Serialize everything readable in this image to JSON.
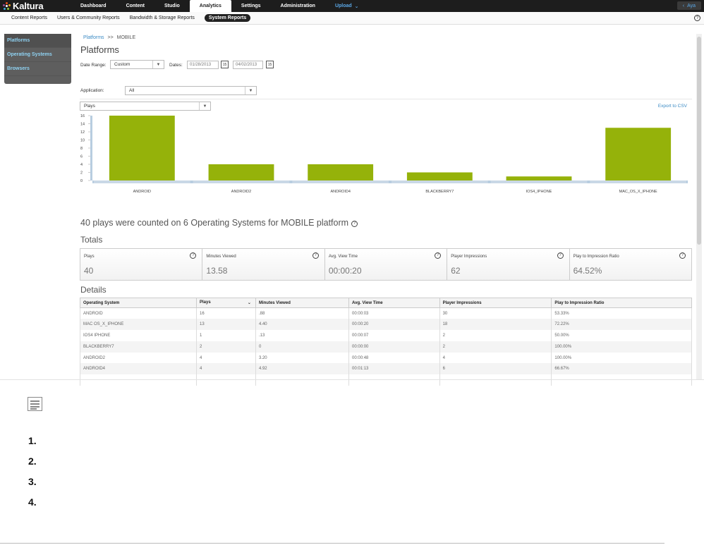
{
  "app": {
    "logo_text": "Kaltura",
    "brand_colors": [
      "#e94e1b",
      "#f7a21b",
      "#8cc63e",
      "#3aa8e0",
      "#9b4a9b"
    ]
  },
  "topnav": {
    "tabs": [
      {
        "label": "Dashboard",
        "active": false
      },
      {
        "label": "Content",
        "active": false
      },
      {
        "label": "Studio",
        "active": false
      },
      {
        "label": "Analytics",
        "active": true
      },
      {
        "label": "Settings",
        "active": false
      },
      {
        "label": "Administration",
        "active": false
      }
    ],
    "upload_label": "Upload",
    "user_label": "Aya"
  },
  "subnav": {
    "items": [
      {
        "label": "Content Reports",
        "active": false
      },
      {
        "label": "Users & Community Reports",
        "active": false
      },
      {
        "label": "Bandwidth & Storage Reports",
        "active": false
      },
      {
        "label": "System Reports",
        "active": true
      }
    ],
    "help": "?"
  },
  "sidebar": {
    "items": [
      {
        "label": "Platforms",
        "active": true
      },
      {
        "label": "Operating Systems",
        "active": false
      },
      {
        "label": "Browsers",
        "active": false
      }
    ]
  },
  "breadcrumb": {
    "link": "Platforms",
    "separator": ">>",
    "current": "MOBILE"
  },
  "page_title": "Platforms",
  "filters": {
    "date_range_label": "Date Range:",
    "date_range_value": "Custom",
    "dates_label": "Dates:",
    "date_from": "01/28/2013",
    "date_to": "04/02/2013",
    "application_label": "Application:",
    "application_value": "All",
    "metric_value": "Plays"
  },
  "export_label": "Export to CSV",
  "chart_data": {
    "type": "bar",
    "categories": [
      "ANDROID",
      "ANDROID2",
      "ANDROID4",
      "BLACKBERRY7",
      "IOS4_IPHONE",
      "MAC_OS_X_IPHONE"
    ],
    "values": [
      16,
      4,
      4,
      2,
      1,
      13
    ],
    "yticks": [
      0,
      2,
      4,
      6,
      8,
      10,
      12,
      14,
      16
    ],
    "ylim": [
      0,
      16
    ],
    "bar_color": "#95b20a",
    "axis_color": "#b8cde0"
  },
  "summary_text": "40 plays were counted on 6 Operating Systems for MOBILE platform",
  "totals_title": "Totals",
  "totals": [
    {
      "label": "Plays",
      "value": "40"
    },
    {
      "label": "Minutes Viewed",
      "value": "13.58"
    },
    {
      "label": "Avg. View Time",
      "value": "00:00:20"
    },
    {
      "label": "Player Impressions",
      "value": "62"
    },
    {
      "label": "Play to Impression Ratio",
      "value": "64.52%"
    }
  ],
  "details_title": "Details",
  "details": {
    "columns": [
      "Operating System",
      "Plays",
      "Minutes Viewed",
      "Avg. View Time",
      "Player Impressions",
      "Play to Impression Ratio"
    ],
    "sort_indicator": "⌄",
    "rows": [
      [
        "ANDROID",
        "16",
        ".88",
        "00:00:03",
        "30",
        "53.33%"
      ],
      [
        "MAC OS_X_IPHONE",
        "13",
        "4.40",
        "00:00:20",
        "18",
        "72.22%"
      ],
      [
        "IOS4 IPHONE",
        "1",
        ".13",
        "00:00:07",
        "2",
        "50.00%"
      ],
      [
        "BLACKBERRY7",
        "2",
        "0",
        "00:00:00",
        "2",
        "100.00%"
      ],
      [
        "ANDROID2",
        "4",
        "3.20",
        "00:00:48",
        "4",
        "100.00%"
      ],
      [
        "ANDROID4",
        "4",
        "4.92",
        "00:01:13",
        "6",
        "66.67%"
      ],
      [
        "",
        "",
        "",
        "",
        "",
        ""
      ]
    ]
  },
  "steps": [
    "1.",
    "2.",
    "3.",
    "4."
  ]
}
